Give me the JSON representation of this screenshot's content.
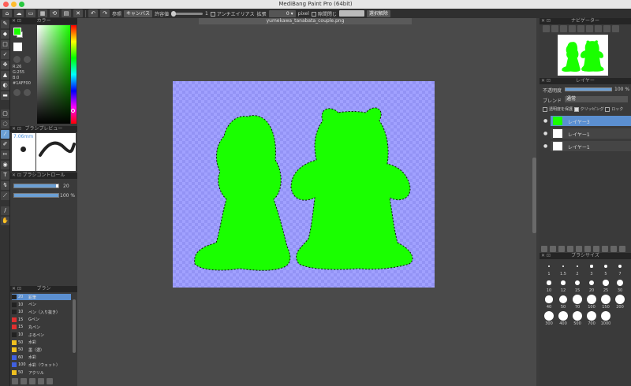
{
  "window": {
    "title": "MediBang Paint Pro (64bit)"
  },
  "toolbar": {
    "ref_label": "参照",
    "ref_value": "キャンバス",
    "tolerance_label": "許容値",
    "tolerance_value": "1",
    "antialias_label": "アンチエイリアス",
    "expand_label": "拡張",
    "expand_value": "0",
    "unit": "pixel",
    "gap_close_label": "隙間閉じ",
    "deselect_label": "選択解除"
  },
  "file": {
    "name": "yumekawa_tanabata_couple.png"
  },
  "color_panel": {
    "title": "カラー",
    "r": "R:26",
    "g": "G:255",
    "b": "B:0",
    "hex": "#1AFF00",
    "main_color": "#1AFF00"
  },
  "brush_preview": {
    "title": "ブラシプレビュー",
    "size": "7.06mm"
  },
  "brush_control": {
    "title": "ブラシコントロール",
    "size_value": "20",
    "opacity_value": "100 %",
    "size_fraction": 0.95,
    "opacity_fraction": 1.0
  },
  "brush_list": {
    "title": "ブラシ",
    "items": [
      {
        "size": "20",
        "name": "鉛筆",
        "color": "#222222",
        "selected": true
      },
      {
        "size": "10",
        "name": "ペン",
        "color": "#222222",
        "selected": false
      },
      {
        "size": "10",
        "name": "ペン（入り抜き）",
        "color": "#222222",
        "selected": false
      },
      {
        "size": "15",
        "name": "Gペン",
        "color": "#e03030",
        "selected": false
      },
      {
        "size": "15",
        "name": "丸ペン",
        "color": "#e03030",
        "selected": false
      },
      {
        "size": "10",
        "name": "ぶるペン",
        "color": "#222222",
        "selected": false
      },
      {
        "size": "50",
        "name": "水彩",
        "color": "#f0c020",
        "selected": false
      },
      {
        "size": "50",
        "name": "墨（濃）",
        "color": "#f0c020",
        "selected": false
      },
      {
        "size": "60",
        "name": "水彩",
        "color": "#4060e0",
        "selected": false
      },
      {
        "size": "100",
        "name": "水彩（ウェット）",
        "color": "#4060e0",
        "selected": false
      },
      {
        "size": "50",
        "name": "アクリル",
        "color": "#f0c020",
        "selected": false
      }
    ]
  },
  "navigator": {
    "title": "ナビゲーター"
  },
  "layers": {
    "title": "レイヤー",
    "opacity_label": "不透明度",
    "opacity_value": "100 %",
    "blend_label": "ブレンド",
    "blend_value": "通常",
    "protect_label": "透明度を保護",
    "clipping_label": "クリッピング",
    "lock_label": "ロック",
    "items": [
      {
        "name": "レイヤー3",
        "selected": true
      },
      {
        "name": "レイヤー1",
        "selected": false
      },
      {
        "name": "レイヤー1",
        "selected": false
      }
    ]
  },
  "brush_size": {
    "title": "ブラシサイズ",
    "sizes": [
      "1",
      "1.5",
      "2",
      "3",
      "5",
      "7",
      "10",
      "12",
      "15",
      "20",
      "25",
      "30",
      "40",
      "50",
      "70",
      "100",
      "150",
      "200",
      "300",
      "400",
      "500",
      "700",
      "1000"
    ]
  }
}
